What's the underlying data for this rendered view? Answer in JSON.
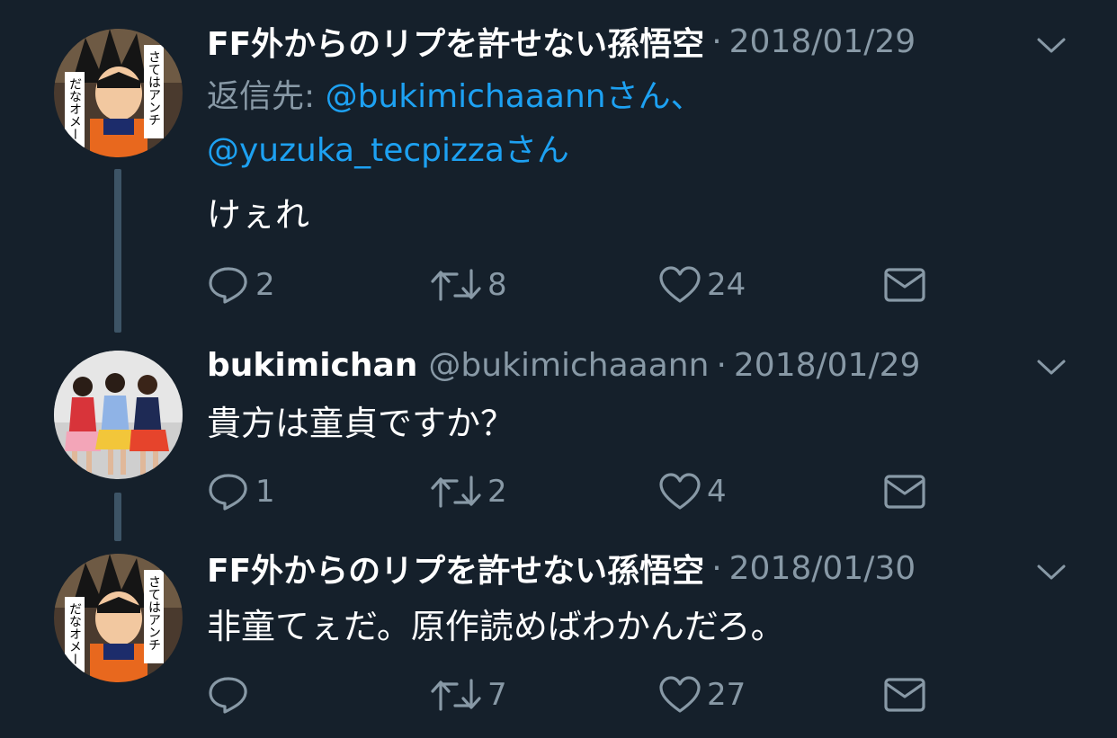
{
  "tweets": [
    {
      "name": "FF外からのリプを許せない孫悟空",
      "handle": "",
      "separator": "·",
      "date": "2018/01/29",
      "reply_prefix": "返信先: ",
      "reply_to_1": "@bukimichaaannさん、",
      "reply_to_2": "@yuzuka_tecpizzaさん",
      "text": "けぇれ",
      "avatar_caption": [
        "さてはアンチ",
        "だなオメー"
      ],
      "replies": "2",
      "retweets": "8",
      "likes": "24"
    },
    {
      "name": "bukimichan",
      "handle": "@bukimichaaann",
      "separator": "·",
      "date": "2018/01/29",
      "text": "貴方は童貞ですか？",
      "replies": "1",
      "retweets": "2",
      "likes": "4"
    },
    {
      "name": "FF外からのリプを許せない孫悟空",
      "handle": "",
      "separator": "·",
      "date": "2018/01/30",
      "text": "非童てぇだ。原作読めばわかんだろ。",
      "avatar_caption": [
        "さてはアンチ",
        "だなオメー"
      ],
      "replies": "",
      "retweets": "7",
      "likes": "27"
    }
  ],
  "icons": {
    "reply": "reply-bubble-icon",
    "retweet": "retweet-arrows-icon",
    "like": "heart-outline-icon",
    "dm": "envelope-icon",
    "menu": "chevron-down-icon"
  },
  "colors": {
    "background": "#15202b",
    "text_primary": "#ffffff",
    "text_secondary": "#8899a6",
    "link": "#1da1f2",
    "thread_line": "#3d5466"
  }
}
